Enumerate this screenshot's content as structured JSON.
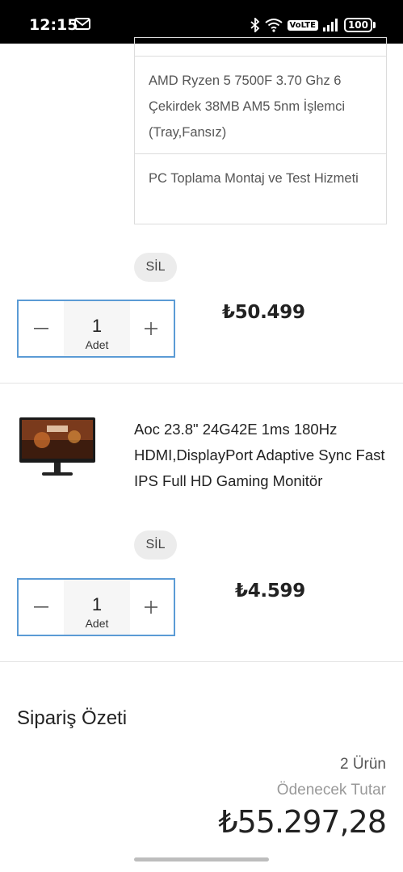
{
  "status_bar": {
    "time": "12:15",
    "volte": "VoLTE",
    "battery": "100"
  },
  "cart": {
    "items": [
      {
        "components": [
          "AMD Ryzen 5 7500F 3.70 Ghz 6 Çekirdek 38MB AM5 5nm İşlemci (Tray,Fansız)",
          "PC Toplama Montaj ve Test Hizmeti"
        ],
        "remove_label": "SİL",
        "quantity": "1",
        "unit": "Adet",
        "price": "₺50.499"
      },
      {
        "name": "Aoc 23.8\" 24G42E 1ms 180Hz HDMI,DisplayPort Adaptive Sync Fast IPS Full HD Gaming Monitör",
        "thumbnail_icon": "monitor-icon",
        "remove_label": "SİL",
        "quantity": "1",
        "unit": "Adet",
        "price": "₺4.599"
      }
    ]
  },
  "summary": {
    "title": "Sipariş Özeti",
    "item_count": "2 Ürün",
    "payable_label": "Ödenecek Tutar",
    "total": "₺55.297,28"
  },
  "colors": {
    "accent_border": "#5b9bd5",
    "pill_bg": "#ececec"
  }
}
